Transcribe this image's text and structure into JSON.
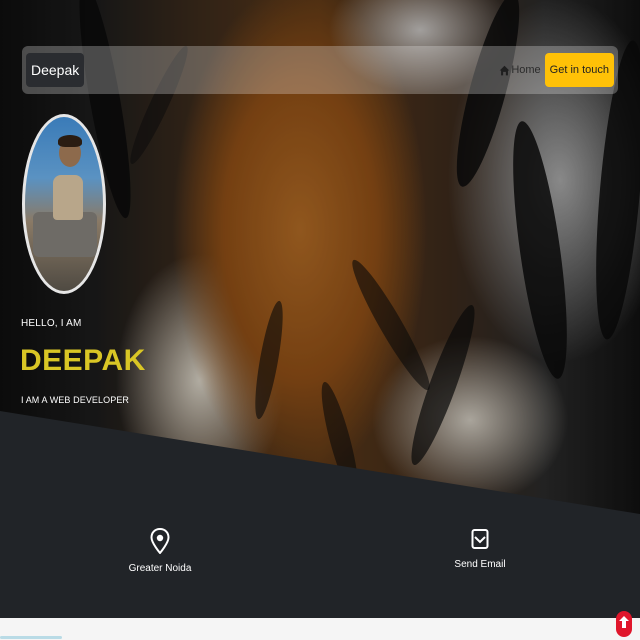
{
  "navbar": {
    "brand": "Deepak",
    "home_label": "Home",
    "cta_label": "Get in touch"
  },
  "hero": {
    "greeting": "HELLO, I AM",
    "name": "DEEPAK",
    "tagline": "I AM A WEB DEVELOPER"
  },
  "contacts": {
    "location": "Greater Noida",
    "email": "Send Email"
  },
  "colors": {
    "accent": "#ffc107",
    "name": "#d9c625",
    "dark": "#212428",
    "scroll_button": "#e0162b"
  },
  "icons": {
    "home": "home-icon",
    "location": "location-pin-icon",
    "email": "envelope-icon",
    "scroll_top": "arrow-up-icon"
  }
}
